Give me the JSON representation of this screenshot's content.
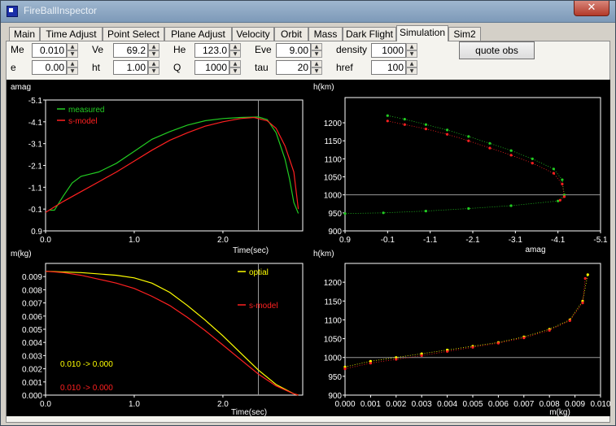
{
  "window": {
    "title": "FireBallInspector",
    "close_label": "✕"
  },
  "tabs": [
    "Main",
    "Time Adjust",
    "Point Select",
    "Plane Adjust",
    "Velocity",
    "Orbit",
    "Mass",
    "Dark Flight",
    "Simulation",
    "Sim2"
  ],
  "active_tab": "Simulation",
  "params": {
    "Me": {
      "label": "Me",
      "value": "0.010"
    },
    "Ve": {
      "label": "Ve",
      "value": "69.2"
    },
    "He": {
      "label": "He",
      "value": "123.0"
    },
    "Eve": {
      "label": "Eve",
      "value": "9.00"
    },
    "density": {
      "label": "density",
      "value": "1000"
    },
    "e": {
      "label": "e",
      "value": "0.00"
    },
    "ht": {
      "label": "ht",
      "value": "1.00"
    },
    "Q": {
      "label": "Q",
      "value": "1000"
    },
    "tau": {
      "label": "tau",
      "value": "20"
    },
    "href": {
      "label": "href",
      "value": "100"
    }
  },
  "button_quote_obs": "quote obs",
  "colors": {
    "measured": "#22cc22",
    "model": "#ff2020",
    "optical": "#ffff00",
    "axes": "#ffffff",
    "ref": "#9a9a9a"
  },
  "chart_data": [
    {
      "type": "line",
      "ylabel": "amag",
      "xlabel": "Time(sec)",
      "xlim": [
        0,
        2.9
      ],
      "ylim": [
        0.9,
        -5.1
      ],
      "x_ticks": [
        "0.0",
        "1.0",
        "2.0"
      ],
      "y_ticks": [
        "-5.1",
        "-4.1",
        "-3.1",
        "-2.1",
        "-1.1",
        "-0.1",
        "0.9"
      ],
      "legend": "top-left",
      "reference_vline_x": 2.4,
      "series": [
        {
          "name": "measured",
          "x": [
            0.05,
            0.1,
            0.2,
            0.3,
            0.4,
            0.5,
            0.6,
            0.8,
            1.0,
            1.2,
            1.4,
            1.6,
            1.8,
            2.0,
            2.2,
            2.4,
            2.5,
            2.6,
            2.7,
            2.75,
            2.8,
            2.85
          ],
          "y": [
            -0.05,
            -0.05,
            -0.7,
            -1.3,
            -1.6,
            -1.7,
            -1.8,
            -2.2,
            -2.75,
            -3.3,
            -3.65,
            -3.95,
            -4.15,
            -4.25,
            -4.3,
            -4.32,
            -4.2,
            -3.6,
            -2.4,
            -1.5,
            -0.4,
            0.1
          ]
        },
        {
          "name": "s-model",
          "x": [
            0.0,
            0.2,
            0.4,
            0.6,
            0.8,
            1.0,
            1.2,
            1.4,
            1.6,
            1.8,
            2.0,
            2.2,
            2.35,
            2.5,
            2.6,
            2.7,
            2.8,
            2.85
          ],
          "y": [
            0.05,
            -0.45,
            -0.9,
            -1.35,
            -1.8,
            -2.3,
            -2.8,
            -3.25,
            -3.6,
            -3.9,
            -4.1,
            -4.25,
            -4.3,
            -4.15,
            -3.8,
            -3.0,
            -1.8,
            -0.1
          ]
        }
      ]
    },
    {
      "type": "scatter",
      "ylabel": "h(km)",
      "xlabel": "amag",
      "xlim": [
        0.9,
        -5.1
      ],
      "ylim": [
        900,
        1270
      ],
      "x_ticks": [
        "0.9",
        "-0.1",
        "-1.1",
        "-2.1",
        "-3.1",
        "-4.1",
        "-5.1"
      ],
      "y_ticks": [
        "900",
        "950",
        "1000",
        "1050",
        "1100",
        "1150",
        "1200"
      ],
      "reference_hline_y": 1000,
      "series": [
        {
          "name": "measured",
          "x": [
            -0.1,
            -0.5,
            -1.0,
            -1.5,
            -2.0,
            -2.5,
            -3.0,
            -3.5,
            -4.0,
            -4.2,
            -4.25,
            -4.1,
            -3.0,
            -2.0,
            -1.0,
            0.0,
            0.9
          ],
          "y": [
            1220,
            1210,
            1195,
            1180,
            1162,
            1143,
            1123,
            1100,
            1072,
            1042,
            1000,
            983,
            970,
            962,
            955,
            950,
            948
          ]
        },
        {
          "name": "s-model",
          "x": [
            -0.1,
            -0.5,
            -1.0,
            -1.5,
            -2.0,
            -2.5,
            -3.0,
            -3.5,
            -4.0,
            -4.2,
            -4.25,
            -4.15
          ],
          "y": [
            1205,
            1195,
            1183,
            1168,
            1150,
            1130,
            1110,
            1088,
            1060,
            1030,
            995,
            985
          ]
        }
      ]
    },
    {
      "type": "line",
      "ylabel": "m(kg)",
      "xlabel": "Time(sec)",
      "xlim": [
        0,
        2.9
      ],
      "ylim": [
        0,
        0.01
      ],
      "x_ticks": [
        "0.0",
        "1.0",
        "2.0"
      ],
      "y_ticks": [
        "0.000",
        "0.001",
        "0.002",
        "0.003",
        "0.004",
        "0.005",
        "0.006",
        "0.007",
        "0.008",
        "0.009"
      ],
      "reference_vline_x": 2.4,
      "annotations": [
        {
          "text": "0.010 -> 0.000",
          "color": "#ffff00"
        },
        {
          "text": "0.010 -> 0.000",
          "color": "#ff2020"
        }
      ],
      "series": [
        {
          "name": "optial",
          "x": [
            0.0,
            0.4,
            0.8,
            1.0,
            1.2,
            1.4,
            1.6,
            1.8,
            2.0,
            2.2,
            2.4,
            2.6,
            2.8,
            2.85
          ],
          "y": [
            0.0094,
            0.0093,
            0.0091,
            0.0089,
            0.0085,
            0.0078,
            0.0068,
            0.0057,
            0.0045,
            0.0032,
            0.0019,
            0.0008,
            0.0001,
            0.0
          ]
        },
        {
          "name": "s-model",
          "x": [
            0.0,
            0.2,
            0.4,
            0.6,
            0.8,
            1.0,
            1.2,
            1.4,
            1.6,
            1.8,
            2.0,
            2.2,
            2.4,
            2.6,
            2.8,
            2.85
          ],
          "y": [
            0.0094,
            0.0093,
            0.0091,
            0.0088,
            0.0085,
            0.0081,
            0.0075,
            0.0068,
            0.0059,
            0.0049,
            0.0038,
            0.0027,
            0.0016,
            0.0007,
            0.0001,
            0.0
          ]
        }
      ]
    },
    {
      "type": "scatter",
      "ylabel": "h(km)",
      "xlabel": "m(kg)",
      "xlim": [
        0,
        0.01
      ],
      "ylim": [
        900,
        1250
      ],
      "x_ticks": [
        "0.000",
        "0.001",
        "0.002",
        "0.003",
        "0.004",
        "0.005",
        "0.006",
        "0.007",
        "0.008",
        "0.009",
        "0.010"
      ],
      "y_ticks": [
        "900",
        "950",
        "1000",
        "1050",
        "1100",
        "1150",
        "1200"
      ],
      "reference_hline_y": 1000,
      "series": [
        {
          "name": "optial",
          "x": [
            0.0,
            0.001,
            0.002,
            0.003,
            0.004,
            0.005,
            0.006,
            0.007,
            0.008,
            0.0088,
            0.0093,
            0.0095
          ],
          "y": [
            975,
            990,
            1000,
            1010,
            1020,
            1030,
            1040,
            1055,
            1075,
            1100,
            1150,
            1220
          ]
        },
        {
          "name": "s-model",
          "x": [
            0.0,
            0.001,
            0.002,
            0.003,
            0.004,
            0.005,
            0.006,
            0.007,
            0.008,
            0.0088,
            0.0093,
            0.0094
          ],
          "y": [
            970,
            985,
            995,
            1005,
            1016,
            1027,
            1038,
            1052,
            1072,
            1098,
            1145,
            1210
          ]
        }
      ]
    }
  ]
}
